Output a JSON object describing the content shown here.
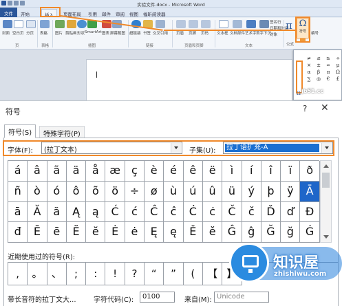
{
  "word": {
    "title": "实验文件.docx - Microsoft Word",
    "tabs": [
      "文件",
      "开始",
      "插入",
      "页面布局",
      "引用",
      "邮件",
      "审阅",
      "视图",
      "福昕阅读器"
    ],
    "ribbon_labels": [
      "封面",
      "空白页",
      "分页",
      "表格",
      "图片",
      "剪贴画",
      "形状",
      "SmartArt",
      "图表",
      "屏幕截图",
      "超链接",
      "书签",
      "交叉引用",
      "页眉",
      "页脚",
      "页码",
      "文本框",
      "文档部件",
      "艺术字",
      "首字下沉",
      "签名行",
      "日期和时间",
      "对象",
      "公式",
      "符号",
      "编号"
    ],
    "group_labels": [
      "页",
      "表格",
      "插图",
      "链接",
      "页眉和页脚",
      "文本"
    ],
    "omega_label": "符号",
    "dropdown_symbols": [
      "≠",
      "≤",
      "≥",
      "÷",
      "×",
      "±",
      "∞",
      "μ",
      "α",
      "β",
      "π",
      "Ω",
      "∑",
      "◎",
      "€",
      "£"
    ],
    "dropdown_omega": "Ω",
    "site_watermark": "jb51.cc"
  },
  "dialog": {
    "title": "符号",
    "help": "?",
    "close": "✕",
    "tab_symbols": "符号(S)",
    "tab_special": "特殊字符(P)",
    "font_label": "字体(F):",
    "font_value": "(拉丁文本)",
    "subset_label": "子集(U):",
    "subset_value": "拉丁语扩充-A",
    "symbols": [
      "á",
      "â",
      "ã",
      "ä",
      "å",
      "æ",
      "ç",
      "è",
      "é",
      "ê",
      "ë",
      "ì",
      "í",
      "î",
      "ï",
      "ð",
      "ñ",
      "ò",
      "ó",
      "ô",
      "õ",
      "ö",
      "÷",
      "ø",
      "ù",
      "ú",
      "û",
      "ü",
      "ý",
      "þ",
      "ÿ",
      "Ā",
      "ā",
      "Ă",
      "ă",
      "Ą",
      "ą",
      "Ć",
      "ć",
      "Ĉ",
      "ĉ",
      "Ċ",
      "ċ",
      "Č",
      "č",
      "Ď",
      "ď",
      "Đ",
      "đ",
      "Ē",
      "ē",
      "Ĕ",
      "ĕ",
      "Ė",
      "ė",
      "Ę",
      "ę",
      "Ě",
      "ě",
      "Ĝ",
      "ĝ",
      "Ğ",
      "ğ",
      "Ġ"
    ],
    "selected_index": 31,
    "recent_label": "近期使用过的符号(R):",
    "recent_symbols": [
      ",",
      "。",
      "、",
      ";",
      ":",
      "!",
      "?",
      "“",
      "”",
      "(",
      "【",
      "】"
    ],
    "char_name": "带长音符的拉丁文大...",
    "code_label": "字符代码(C):",
    "code_value": "0100",
    "from_label": "来自(M):",
    "from_value": "Unicode"
  },
  "watermark": {
    "text": "知识屋",
    "url": "zhishiwu.com"
  },
  "colors": {
    "accent": "#f0892a",
    "selection": "#1e66c9",
    "word_blue": "#2b579a"
  }
}
